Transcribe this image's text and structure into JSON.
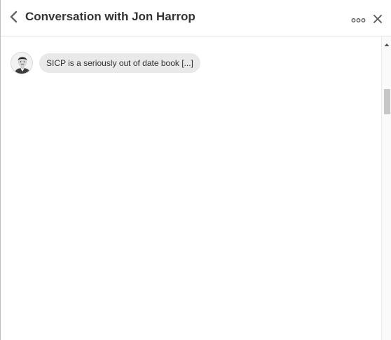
{
  "header": {
    "title": "Conversation with Jon Harrop",
    "back_icon": "chevron-left-icon",
    "more_icon": "more-options-icon",
    "close_icon": "close-icon"
  },
  "messages": [
    {
      "sender": "Jon Harrop",
      "avatar_icon": "avatar",
      "text": "SICP is a seriously out of date book [...]"
    }
  ],
  "colors": {
    "bubble": "#e9e9e9",
    "title_text": "#333333",
    "border": "#e3e3e3"
  }
}
